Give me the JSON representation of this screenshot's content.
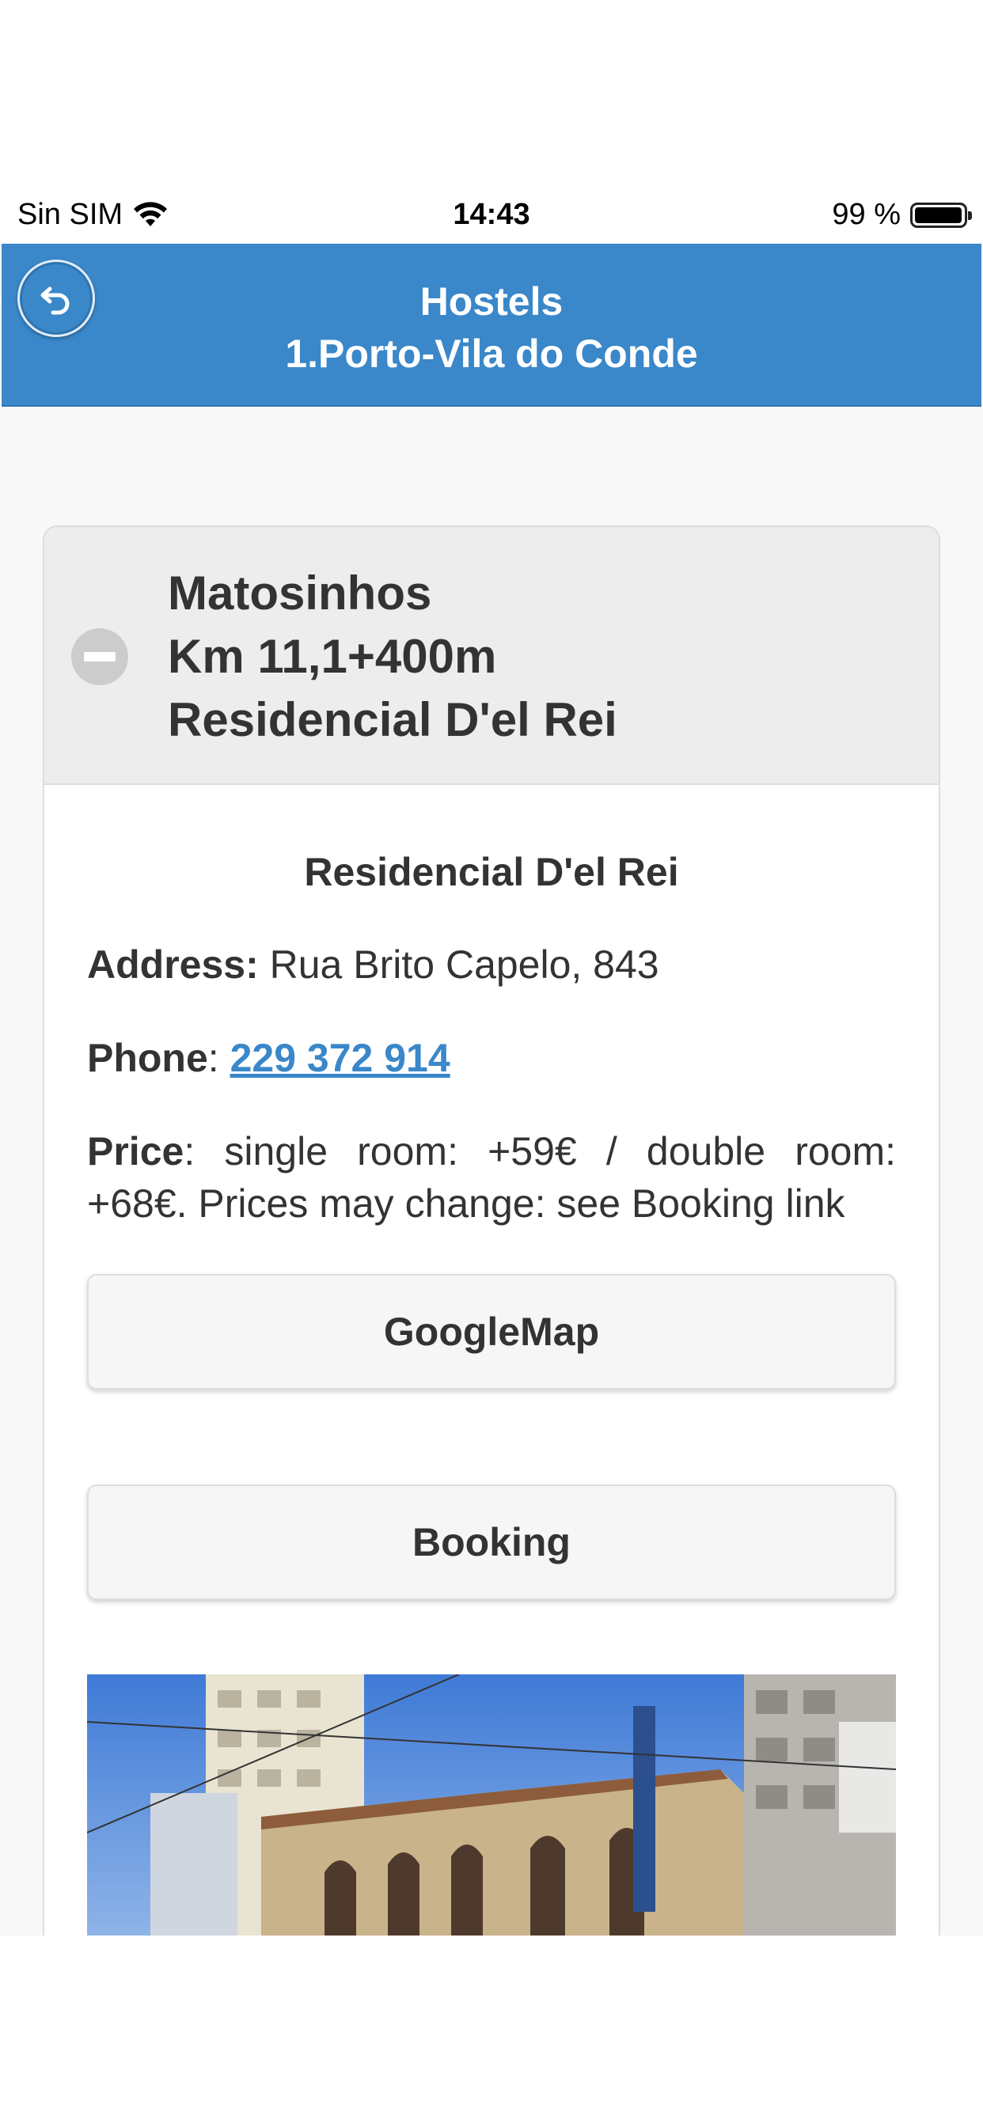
{
  "status_bar": {
    "carrier": "Sin SIM",
    "time": "14:43",
    "battery": "99 %",
    "battery_level": 0.99
  },
  "header": {
    "title_line1": "Hostels",
    "title_line2": "1.Porto-Vila do Conde"
  },
  "collapsible": {
    "heading_line1": "Matosinhos",
    "heading_line2": "Km 11,1+400m",
    "heading_line3": "Residencial D'el Rei"
  },
  "details": {
    "name": "Residencial D'el Rei",
    "address_label": "Address:",
    "address_value": "Rua Brito Capelo, 843",
    "phone_label": "Phone",
    "phone_value": "229 372 914",
    "price_label": "Price",
    "price_value": ": single room: +59€ / double room: +68€. Prices may change: see Booking link"
  },
  "buttons": {
    "map": "GoogleMap",
    "booking": "Booking"
  },
  "colors": {
    "header": "#3a87c9",
    "link": "#3a87c9",
    "background": "#f8f8f8"
  }
}
